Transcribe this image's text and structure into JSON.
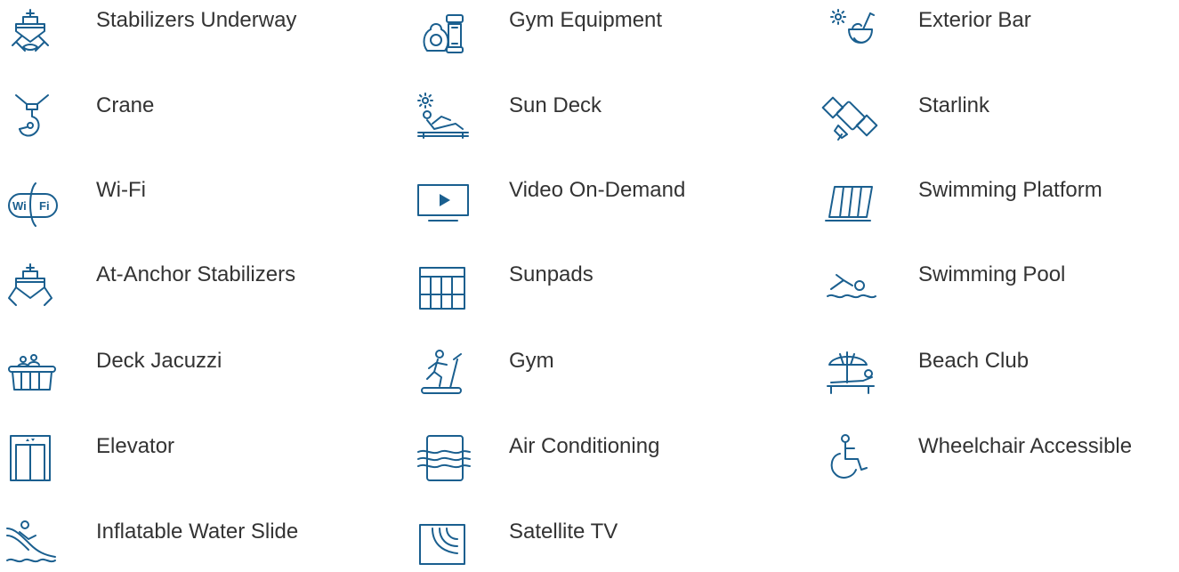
{
  "icon_color": "#1a5f8f",
  "text_color": "#333333",
  "amenities": [
    {
      "label": "Stabilizers Underway",
      "icon": "ship-stabilizers-icon"
    },
    {
      "label": "Gym Equipment",
      "icon": "kettlebell-dumbbell-icon"
    },
    {
      "label": "Exterior Bar",
      "icon": "coconut-drink-icon"
    },
    {
      "label": "Crane",
      "icon": "crane-hook-icon"
    },
    {
      "label": "Sun Deck",
      "icon": "sunbather-icon"
    },
    {
      "label": "Starlink",
      "icon": "satellite-icon"
    },
    {
      "label": "Wi-Fi",
      "icon": "wifi-badge-icon"
    },
    {
      "label": "Video On-Demand",
      "icon": "play-screen-icon"
    },
    {
      "label": "Swimming Platform",
      "icon": "platform-icon"
    },
    {
      "label": "At-Anchor Stabilizers",
      "icon": "ship-anchor-stabilizers-icon"
    },
    {
      "label": "Sunpads",
      "icon": "sunpads-icon"
    },
    {
      "label": "Swimming Pool",
      "icon": "swimmer-icon"
    },
    {
      "label": "Deck Jacuzzi",
      "icon": "jacuzzi-icon"
    },
    {
      "label": "Gym",
      "icon": "treadmill-icon"
    },
    {
      "label": "Beach Club",
      "icon": "umbrella-lounger-icon"
    },
    {
      "label": "Elevator",
      "icon": "elevator-icon"
    },
    {
      "label": "Air Conditioning",
      "icon": "air-conditioner-icon"
    },
    {
      "label": "Wheelchair Accessible",
      "icon": "wheelchair-icon"
    },
    {
      "label": "Inflatable Water Slide",
      "icon": "water-slide-icon"
    },
    {
      "label": "Satellite TV",
      "icon": "satellite-tv-icon"
    }
  ],
  "wifi_badge": {
    "left": "Wi",
    "right": "Fi"
  }
}
